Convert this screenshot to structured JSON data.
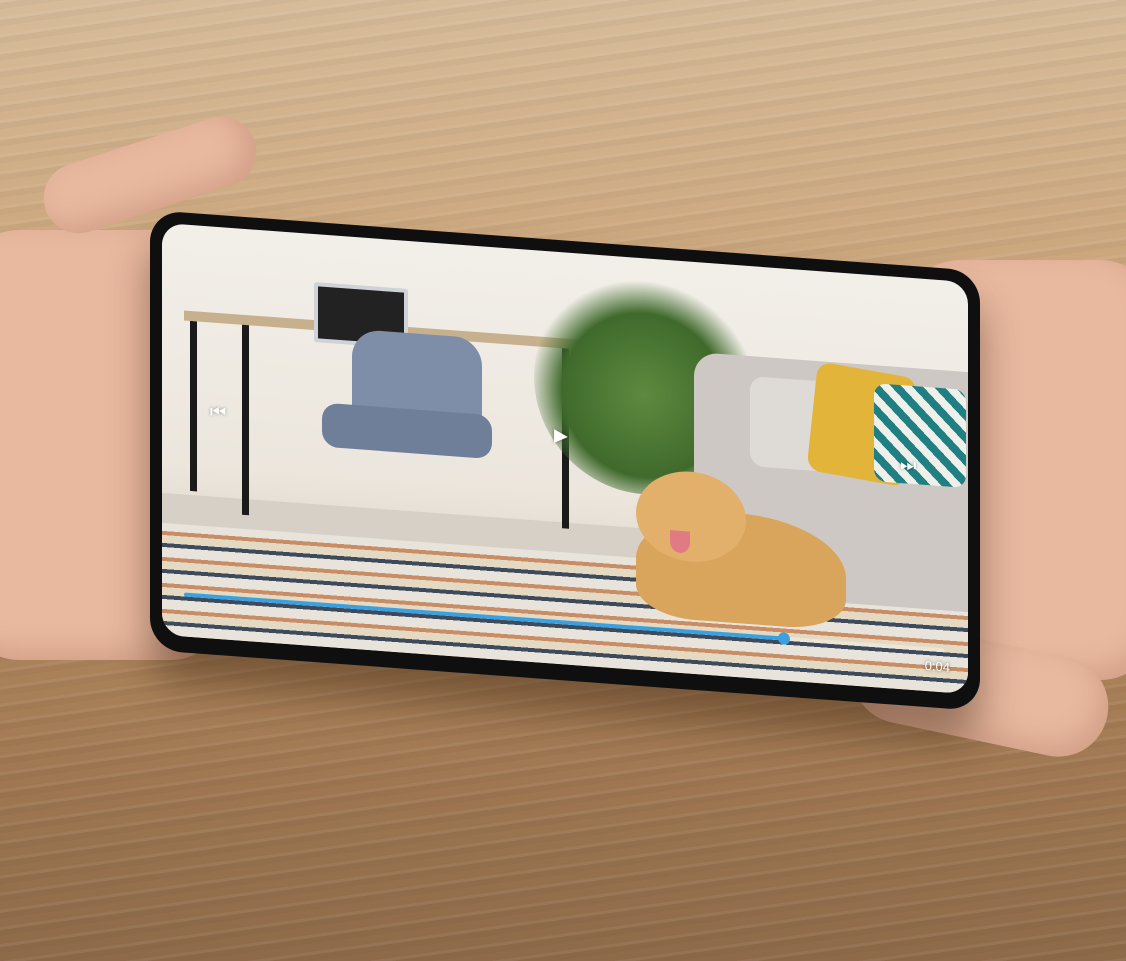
{
  "player": {
    "prev_icon": "⏮",
    "play_icon": "▶",
    "next_icon": "⏭",
    "time": "0:04",
    "progress_fraction": 0.79,
    "accent_color": "#3aa0e0"
  },
  "icons": {
    "prev": "previous-track-icon",
    "play": "play-icon",
    "next": "next-track-icon"
  }
}
